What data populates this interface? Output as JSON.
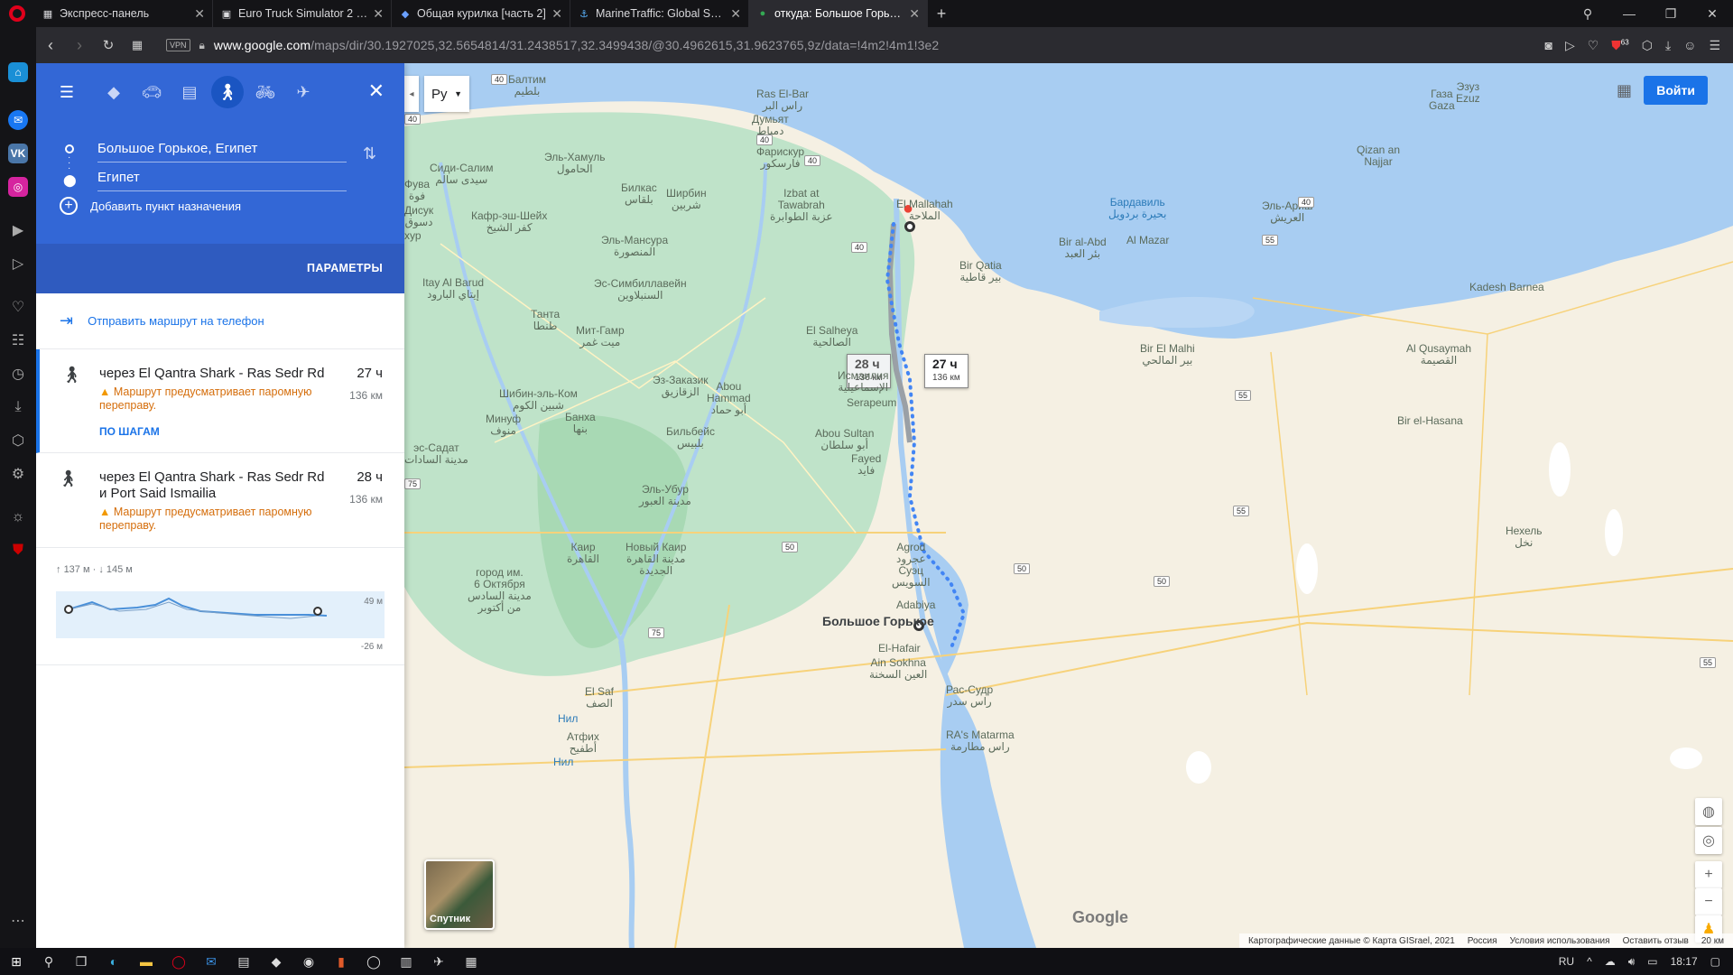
{
  "browser": {
    "tabs": [
      {
        "label": "Экспресс-панель",
        "icon": "grid-icon"
      },
      {
        "label": "Euro Truck Simulator 2 - Ар",
        "icon": "truck-icon"
      },
      {
        "label": "Общая курилка [часть 2]",
        "icon": "forum-icon"
      },
      {
        "label": "MarineTraffic: Global Ship T",
        "icon": "ship-icon"
      },
      {
        "label": "откуда: Большое Горькое",
        "icon": "maps-pin-icon",
        "active": true
      }
    ],
    "url_domain": "www.google.com",
    "url_path": "/maps/dir/30.1927025,32.5654814/31.2438517,32.3499438/@30.4962615,31.9623765,9z/data=!4m2!4m1!3e2",
    "vpn": "VPN",
    "badge_count": "63"
  },
  "directions": {
    "origin": "Большое Горькое, Египет",
    "destination": "Египет",
    "add_destination": "Добавить пункт назначения",
    "params": "ПАРАМЕТРЫ",
    "send_to_phone": "Отправить маршрут на телефон",
    "routes": [
      {
        "via": "через El Qantra Shark - Ras Sedr Rd",
        "warning": "Маршрут предусматривает паромную переправу.",
        "time": "27 ч",
        "distance": "136 км",
        "steps": "ПО ШАГАМ"
      },
      {
        "via": "через El Qantra Shark - Ras Sedr Rd и Port Said Ismailia",
        "warning": "Маршрут предусматривает паромную переправу.",
        "time": "28 ч",
        "distance": "136 км"
      }
    ],
    "elevation": {
      "up": "137 м",
      "down": "145 м",
      "max": "49 м",
      "min": "-26 м"
    }
  },
  "map": {
    "language": "Ру",
    "login": "Войти",
    "satellite": "Спутник",
    "logo": "Google",
    "route_labels": [
      {
        "time": "28 ч",
        "dist": "136 км"
      },
      {
        "time": "27 ч",
        "dist": "136 км"
      }
    ],
    "place_destination": "Большое Горькое",
    "places": [
      {
        "t": "Балтим\nبلطيم"
      },
      {
        "t": "Ras El-Bar\nراس البر"
      },
      {
        "t": "Думьят\nدمياط"
      },
      {
        "t": "Эль-Хамуль\nالحامول"
      },
      {
        "t": "Фарискур\nفارسكور"
      },
      {
        "t": "Сиди-Салим\nسيدى سالم"
      },
      {
        "t": "Билкас\nبلقاس"
      },
      {
        "t": "Ширбин\nشربين"
      },
      {
        "t": "Izbat at\nTawabrah\nعزبة الطوابرة"
      },
      {
        "t": "Дисук\nدسوق"
      },
      {
        "t": "Кафр-эш-Шейх\nكفر الشيخ"
      },
      {
        "t": "Эль-Мансура\nالمنصورة"
      },
      {
        "t": "Itay Al Barud\nإيتاي البارود"
      },
      {
        "t": "Эс-Симбиллавейн\nالسنبلاوين"
      },
      {
        "t": "Танта\nطنطا"
      },
      {
        "t": "Мит-Гамр\nميت غمر"
      },
      {
        "t": "Эз-Заказик\nالزقازيق"
      },
      {
        "t": "Abou\nHammad\nأبو حماد"
      },
      {
        "t": "Шибин-эль-Ком\nشبين الكوم"
      },
      {
        "t": "Минуф\nمنوف"
      },
      {
        "t": "Банха\nبنها"
      },
      {
        "t": "Бильбейс\nبلبيس"
      },
      {
        "t": "Исмаилия\nالإسماعيلية"
      },
      {
        "t": "El Salheya\nالصالحية"
      },
      {
        "t": "Serapeum"
      },
      {
        "t": "Abou Sultan\nأبو سلطان"
      },
      {
        "t": "Fayed\nفايد"
      },
      {
        "t": "Эль-Убур\nمدينة العبور"
      },
      {
        "t": "Каир\nالقاهرة"
      },
      {
        "t": "Новый Каир\nمدينة القاهرة\nالجديدة"
      },
      {
        "t": "город им.\n6 Октября\nمدينة السادس\nمن أكتوبر"
      },
      {
        "t": "Agrod\nعجرود"
      },
      {
        "t": "Суэц\nالسويس"
      },
      {
        "t": "Adabiya"
      },
      {
        "t": "El-Hafair"
      },
      {
        "t": "Ain Sokhna\nالعين السخنة"
      },
      {
        "t": "Рас-Судр\nراس سدر"
      },
      {
        "t": "RA's Matarma\nراس مطارمة"
      },
      {
        "t": "El Saf\nالصف"
      },
      {
        "t": "Атфих\nأطفيح"
      },
      {
        "t": "El Mallahah\nالملاحة"
      },
      {
        "t": "Бардавиль\nبحيرة بردويل"
      },
      {
        "t": "Bir al-Abd\nبئر العبد"
      },
      {
        "t": "Al Mazar"
      },
      {
        "t": "Bir Qatia\nبير قاطية"
      },
      {
        "t": "Эль-Ариш\nالعريش"
      },
      {
        "t": "Qizan an\nNajjar"
      },
      {
        "t": "Газа\nGaza"
      },
      {
        "t": "Kadesh Barnea"
      },
      {
        "t": "Bir El Malhi\nبير المالحي"
      },
      {
        "t": "Al Qusaymah\nالقصيمة"
      },
      {
        "t": "Bir el-Hasana"
      },
      {
        "t": "Нехель\nنخل"
      },
      {
        "t": "Эзуз\nEzuz"
      },
      {
        "t": "Нил"
      },
      {
        "t": "Нил"
      },
      {
        "t": "эс-Садат\nمدينة السادات"
      },
      {
        "t": "хур"
      },
      {
        "t": "Фува\nفوة"
      }
    ],
    "attribution": [
      "Картографические данные © Карта GISrael, 2021",
      "Россия",
      "Условия использования",
      "Оставить отзыв",
      "20 км"
    ],
    "road_badges": [
      "40",
      "40",
      "40",
      "40",
      "40",
      "40",
      "55",
      "55",
      "55",
      "55",
      "50",
      "50",
      "50",
      "75",
      "75"
    ]
  },
  "taskbar": {
    "lang": "RU",
    "time": "18:17"
  }
}
